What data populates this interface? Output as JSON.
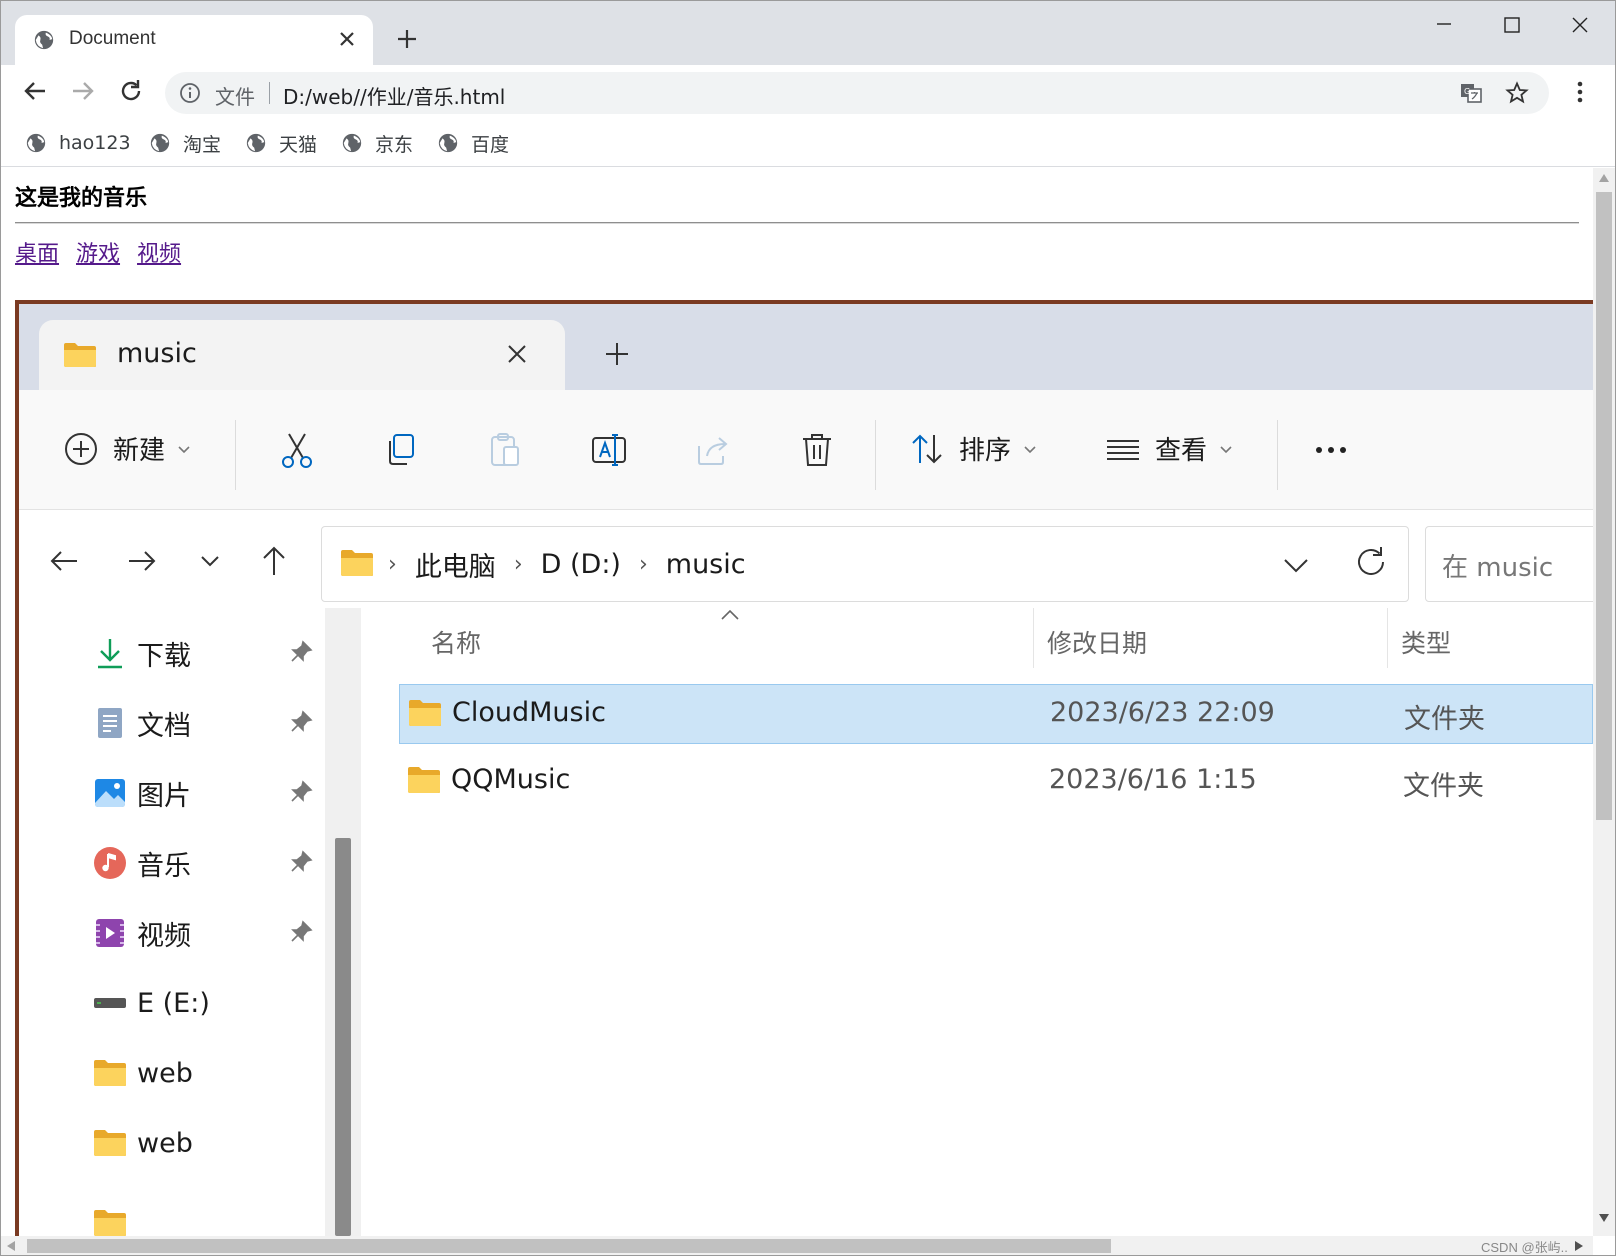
{
  "browser": {
    "tab_title": "Document",
    "url_scheme": "文件",
    "url": "D:/web//作业/音乐.html",
    "bookmarks": [
      "hao123",
      "淘宝",
      "天猫",
      "京东",
      "百度"
    ]
  },
  "page": {
    "heading": "这是我的音乐",
    "links": [
      "桌面",
      "游戏",
      "视频"
    ]
  },
  "explorer": {
    "tab_label": "music",
    "commands": {
      "new": "新建",
      "sort": "排序",
      "view": "查看"
    },
    "breadcrumb": [
      "此电脑",
      "D (D:)",
      "music"
    ],
    "search_placeholder": "在 music",
    "nav_items": [
      {
        "label": "下载",
        "icon": "download-icon",
        "pinned": true
      },
      {
        "label": "文档",
        "icon": "documents-icon",
        "pinned": true
      },
      {
        "label": "图片",
        "icon": "pictures-icon",
        "pinned": true
      },
      {
        "label": "音乐",
        "icon": "music-icon",
        "pinned": true
      },
      {
        "label": "视频",
        "icon": "videos-icon",
        "pinned": true
      },
      {
        "label": "E (E:)",
        "icon": "drive-icon",
        "pinned": false
      },
      {
        "label": "web",
        "icon": "folder-icon",
        "pinned": false
      },
      {
        "label": "web",
        "icon": "folder-icon",
        "pinned": false
      }
    ],
    "columns": {
      "name": "名称",
      "date": "修改日期",
      "type": "类型"
    },
    "files": [
      {
        "name": "CloudMusic",
        "date": "2023/6/23 22:09",
        "type": "文件夹",
        "selected": true
      },
      {
        "name": "QQMusic",
        "date": "2023/6/16 1:15",
        "type": "文件夹",
        "selected": false
      }
    ]
  },
  "watermark": "CSDN @张屿..",
  "colors": {
    "tabstrip": "#dee1e6",
    "link_visited": "#551a8b",
    "selection": "#cce4f7",
    "folder_yellow": "#f8c44c",
    "accent_blue": "#0067c0"
  }
}
